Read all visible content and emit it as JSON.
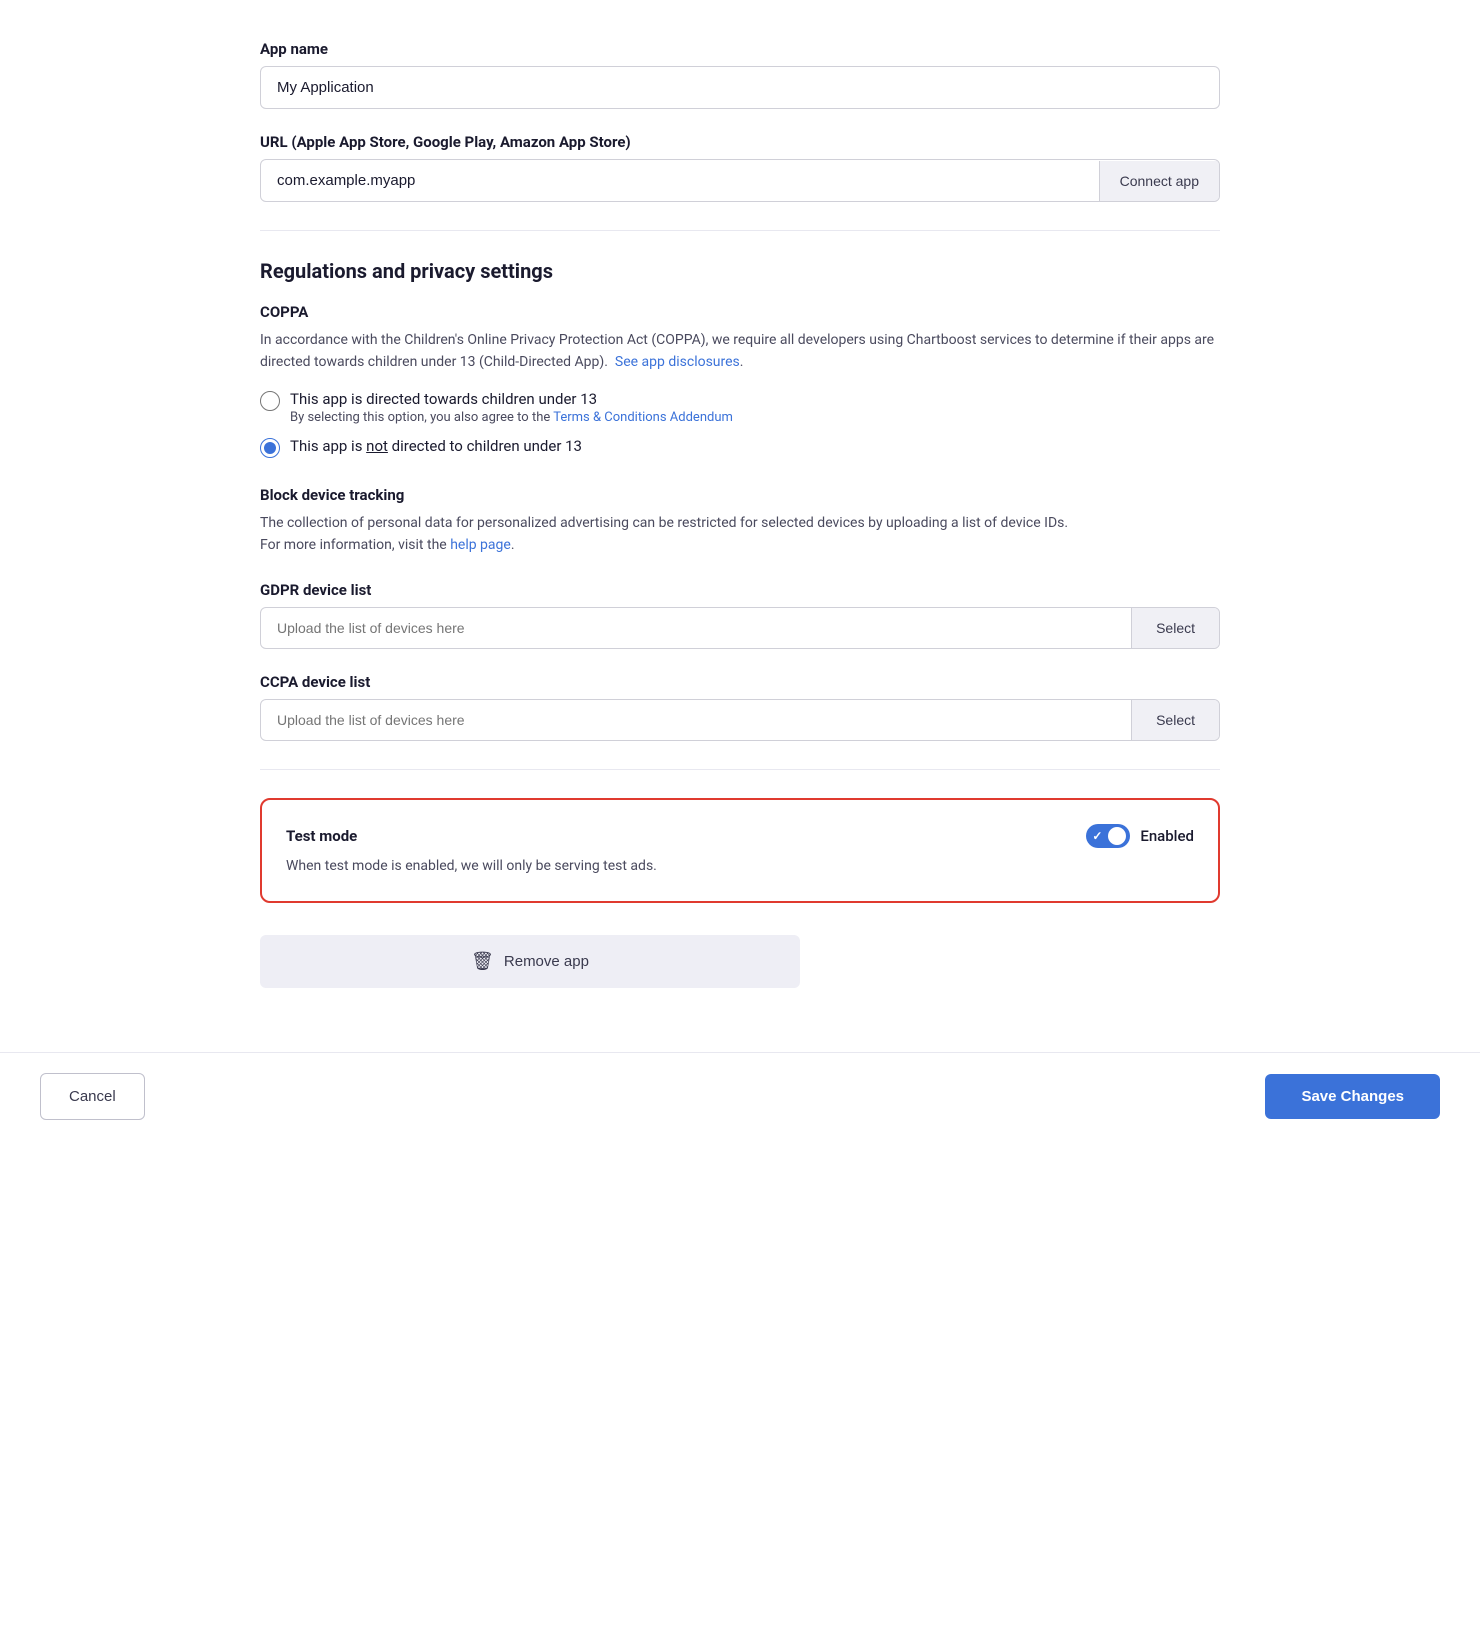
{
  "app_name": {
    "label": "App name",
    "value": "My Application",
    "placeholder": "My Application"
  },
  "url_field": {
    "label": "URL (Apple App Store, Google Play, Amazon App Store)",
    "value": "com.example.myapp",
    "placeholder": "com.example.myapp",
    "connect_button_label": "Connect app"
  },
  "regulations_section": {
    "title": "Regulations and privacy settings",
    "coppa": {
      "subtitle": "COPPA",
      "description_1": "In accordance with the Children's Online Privacy Protection Act (COPPA), we require all developers using Chartboost services to determine if their apps are directed towards children under 13 (Child-Directed App).",
      "see_disclosures_link": "See app disclosures",
      "radio_options": [
        {
          "id": "directed",
          "label": "This app is directed towards children under 13",
          "sublabel": "By selecting this option, you also agree to the",
          "sublabel_link": "Terms & Conditions Addendum",
          "checked": false
        },
        {
          "id": "not_directed",
          "label": "This app is",
          "label_underline": "not",
          "label_suffix": "directed to children under 13",
          "checked": true
        }
      ]
    },
    "block_device_tracking": {
      "subtitle": "Block device tracking",
      "description_1": "The collection of personal data for personalized advertising can be restricted for selected devices by uploading a list of device IDs.",
      "description_2": "For more information, visit the",
      "help_link": "help page"
    },
    "gdpr": {
      "label": "GDPR device list",
      "placeholder": "Upload the list of devices here",
      "select_label": "Select"
    },
    "ccpa": {
      "label": "CCPA device list",
      "placeholder": "Upload the list of devices here",
      "select_label": "Select"
    }
  },
  "test_mode": {
    "title": "Test mode",
    "description": "When test mode is enabled, we will only be serving test ads.",
    "toggle_label": "Enabled",
    "enabled": true
  },
  "remove_app": {
    "label": "Remove app"
  },
  "footer": {
    "cancel_label": "Cancel",
    "save_label": "Save Changes"
  }
}
